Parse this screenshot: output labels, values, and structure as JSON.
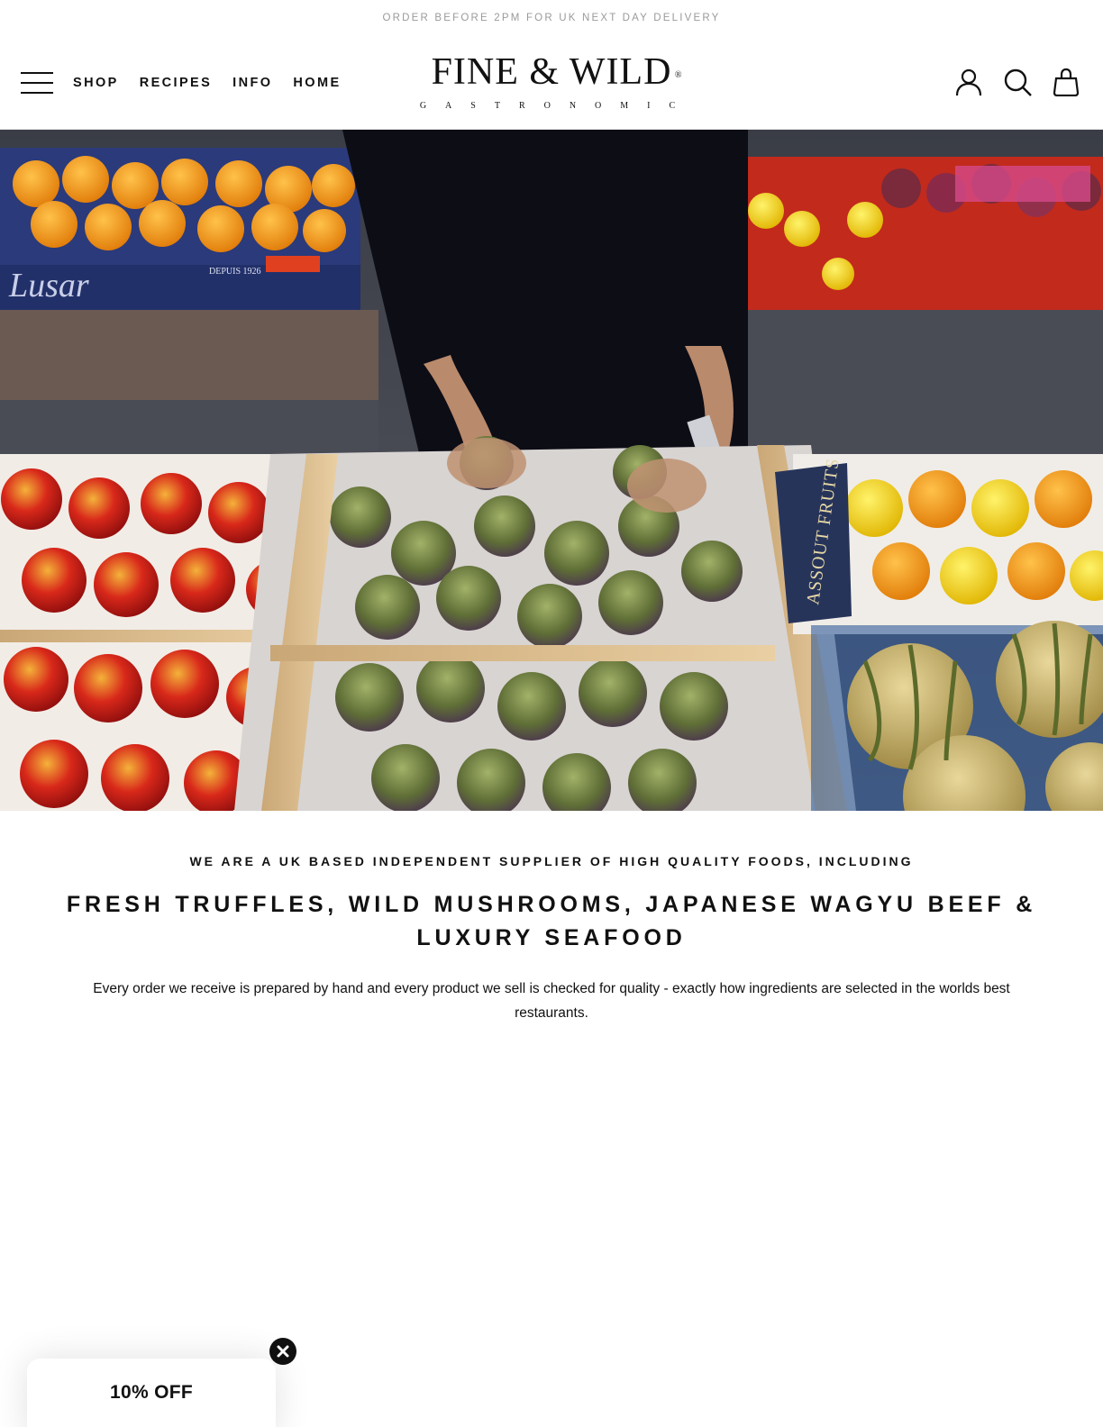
{
  "announcement": {
    "text": "ORDER BEFORE 2PM FOR UK NEXT DAY DELIVERY"
  },
  "header": {
    "menu_icon": "hamburger-menu-icon",
    "nav": [
      {
        "label": "SHOP"
      },
      {
        "label": "RECIPES"
      },
      {
        "label": "INFO"
      },
      {
        "label": "HOME"
      }
    ],
    "logo": {
      "main": "FINE & WILD",
      "registered": "®",
      "sub": "GASTRONOMIC"
    },
    "icons": [
      "account-icon",
      "search-icon",
      "cart-icon"
    ]
  },
  "hero": {
    "crate_text": [
      "Lusar",
      "DEPUIS 1926",
      "ASSOUT FRUITS"
    ]
  },
  "intro": {
    "kicker": "WE ARE A UK BASED INDEPENDENT SUPPLIER OF HIGH QUALITY FOODS, INCLUDING",
    "headline": "FRESH TRUFFLES, WILD MUSHROOMS, JAPANESE WAGYU BEEF & LUXURY SEAFOOD",
    "body": "Every order we receive is prepared by hand and every product we sell is checked for quality - exactly how ingredients are selected in the worlds best restaurants."
  },
  "promo": {
    "label": "10% OFF",
    "close_icon": "close-icon"
  },
  "colors": {
    "text": "#111111",
    "announcement": "#9a9a9a",
    "background": "#ffffff"
  }
}
